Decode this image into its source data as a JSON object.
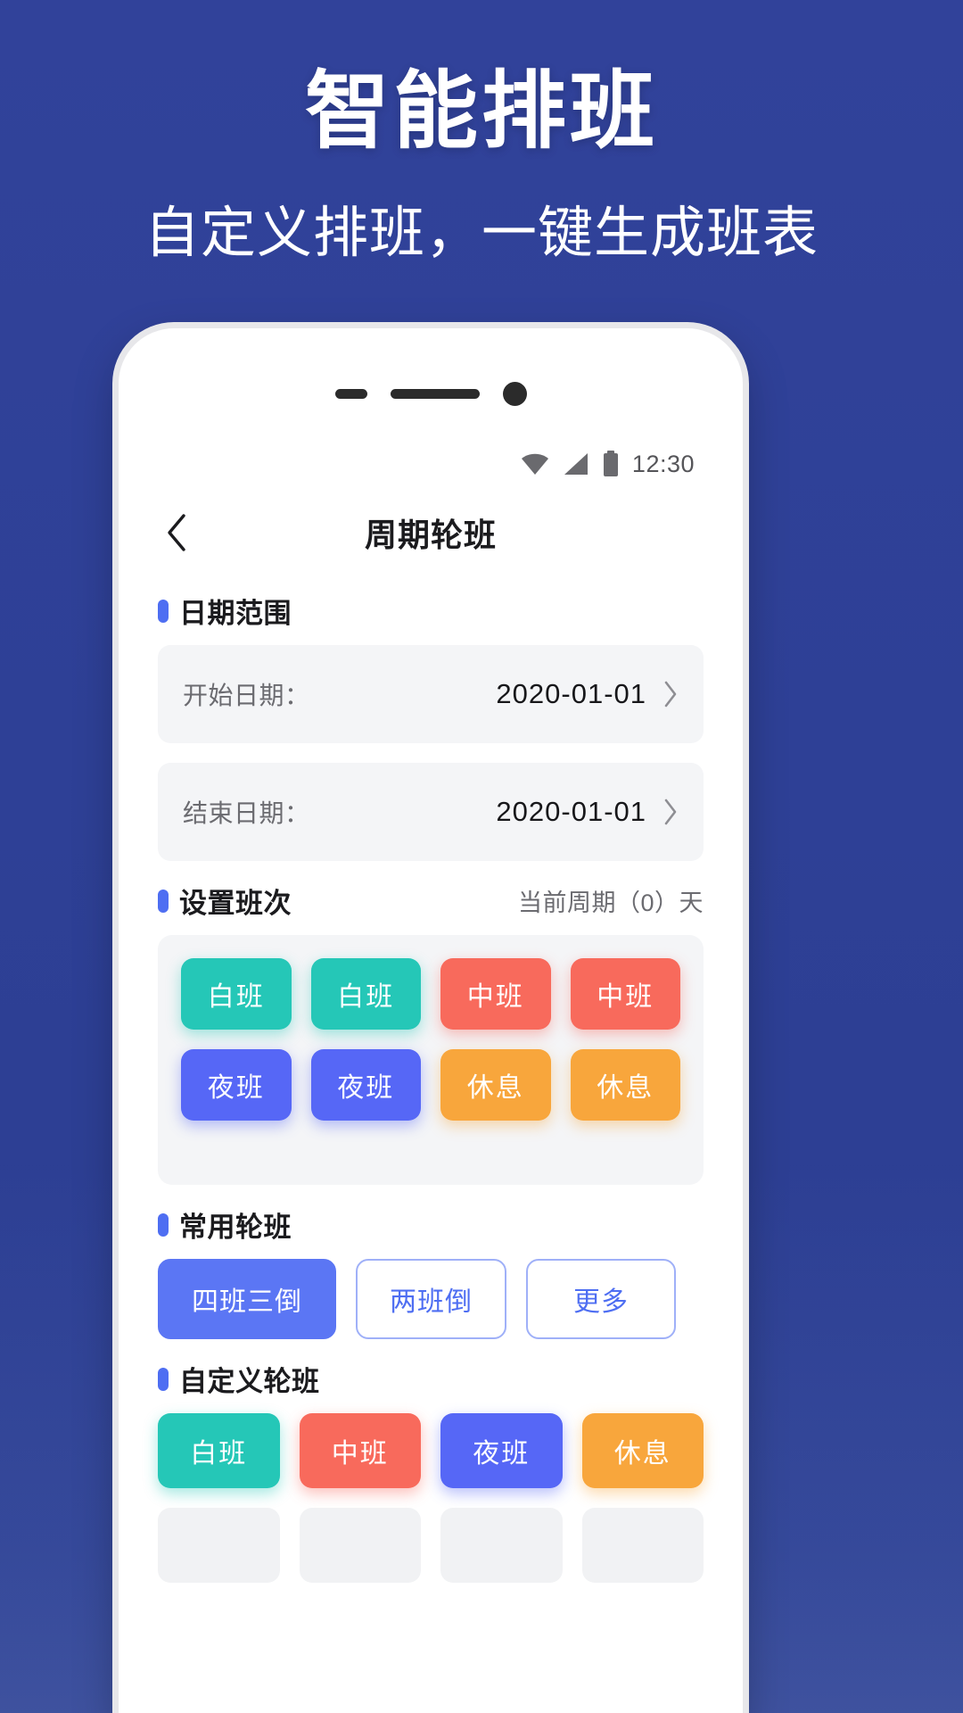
{
  "promo": {
    "title": "智能排班",
    "subtitle": "自定义排班，一键生成班表",
    "bg_color": "#2d4192"
  },
  "phone": {
    "statusbar": {
      "time": "12:30",
      "wifi_icon": "wifi-icon",
      "signal_icon": "signal-icon",
      "battery_icon": "battery-icon"
    },
    "header": {
      "back_icon": "back-chevron-icon",
      "title": "周期轮班"
    },
    "date_range": {
      "section_title": "日期范围",
      "start": {
        "label": "开始日期：",
        "value": "2020-01-01"
      },
      "end": {
        "label": "结束日期：",
        "value": "2020-01-01"
      }
    },
    "shift_setup": {
      "section_title": "设置班次",
      "note": "当前周期（0）天",
      "chips": [
        {
          "label": "白班",
          "color": "teal"
        },
        {
          "label": "白班",
          "color": "teal"
        },
        {
          "label": "中班",
          "color": "red"
        },
        {
          "label": "中班",
          "color": "red"
        },
        {
          "label": "夜班",
          "color": "blue"
        },
        {
          "label": "夜班",
          "color": "blue"
        },
        {
          "label": "休息",
          "color": "orange"
        },
        {
          "label": "休息",
          "color": "orange"
        }
      ]
    },
    "common_rotation": {
      "section_title": "常用轮班",
      "presets": [
        {
          "label": "四班三倒",
          "active": true
        },
        {
          "label": "两班倒",
          "active": false
        },
        {
          "label": "更多",
          "active": false
        }
      ]
    },
    "custom_rotation": {
      "section_title": "自定义轮班",
      "chips": [
        {
          "label": "白班",
          "color": "teal"
        },
        {
          "label": "中班",
          "color": "red"
        },
        {
          "label": "夜班",
          "color": "blue"
        },
        {
          "label": "休息",
          "color": "orange"
        }
      ]
    },
    "colors": {
      "accent": "#4e6ef2",
      "teal": "#25c7b7",
      "red": "#f86a5c",
      "blue": "#5667f6",
      "orange": "#f8a63c"
    }
  }
}
